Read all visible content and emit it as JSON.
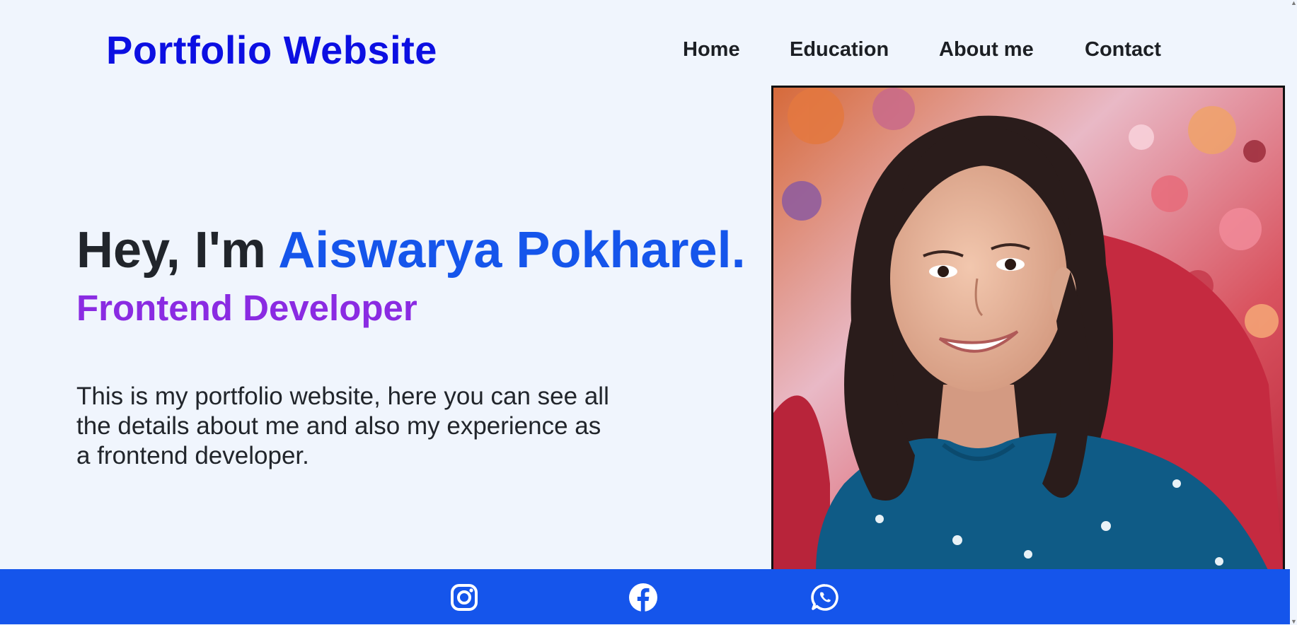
{
  "header": {
    "brand": "Portfolio Website",
    "nav": [
      {
        "label": "Home"
      },
      {
        "label": "Education"
      },
      {
        "label": "About me"
      },
      {
        "label": "Contact"
      }
    ]
  },
  "hero": {
    "greeting_prefix": "Hey, I'm ",
    "name": "Aiswarya Pokharel.",
    "role": "Frontend Developer",
    "intro": "This is my portfolio website, here you can see all the details about me and also my experience as a frontend developer."
  },
  "portrait": {
    "icon": "person-photo"
  },
  "footer": {
    "socials": [
      {
        "icon": "instagram-icon"
      },
      {
        "icon": "facebook-icon"
      },
      {
        "icon": "whatsapp-icon"
      }
    ]
  },
  "colors": {
    "background": "#f0f5fd",
    "brand": "#0c0fe2",
    "accent_blue": "#1555eb",
    "role_purple": "#8a2be2",
    "text": "#21252b"
  }
}
